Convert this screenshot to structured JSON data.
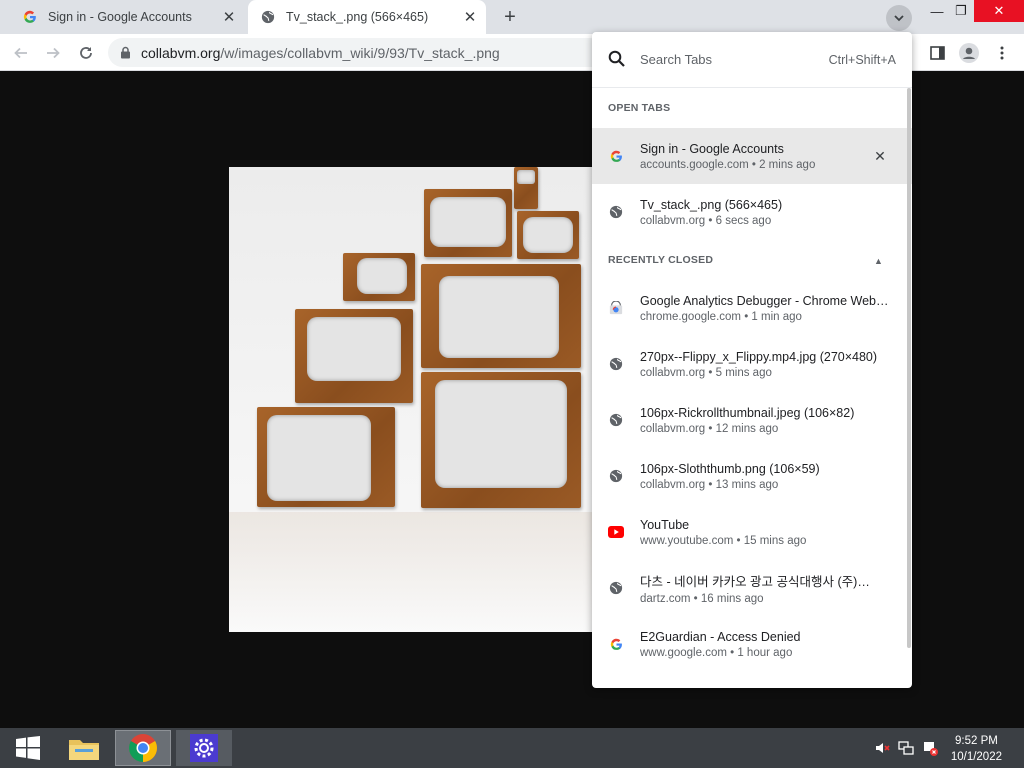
{
  "browser": {
    "tabs": [
      {
        "title": "Sign in - Google Accounts",
        "active": false
      },
      {
        "title": "Tv_stack_.png (566×465)",
        "active": true
      }
    ],
    "address": {
      "host": "collabvm.org",
      "path": "/w/images/collabvm_wiki/9/93/Tv_stack_.png"
    }
  },
  "tab_search": {
    "placeholder": "Search Tabs",
    "shortcut": "Ctrl+Shift+A",
    "open_tabs_header": "OPEN TABS",
    "recently_closed_header": "RECENTLY CLOSED",
    "open_tabs": [
      {
        "title": "Sign in - Google Accounts",
        "subtitle": "accounts.google.com • 2 mins ago",
        "icon": "google-icon"
      },
      {
        "title": "Tv_stack_.png (566×465)",
        "subtitle": "collabvm.org • 6 secs ago",
        "icon": "globe-icon"
      }
    ],
    "recently_closed": [
      {
        "title": "Google Analytics Debugger - Chrome Web…",
        "subtitle": "chrome.google.com • 1 min ago",
        "icon": "webstore-icon"
      },
      {
        "title": "270px--Flippy_x_Flippy.mp4.jpg (270×480)",
        "subtitle": "collabvm.org • 5 mins ago",
        "icon": "globe-icon"
      },
      {
        "title": "106px-Rickrollthumbnail.jpeg (106×82)",
        "subtitle": "collabvm.org • 12 mins ago",
        "icon": "globe-icon"
      },
      {
        "title": "106px-Sloththumb.png (106×59)",
        "subtitle": "collabvm.org • 13 mins ago",
        "icon": "globe-icon"
      },
      {
        "title": "YouTube",
        "subtitle": "www.youtube.com • 15 mins ago",
        "icon": "youtube-icon"
      },
      {
        "title": "다츠 - 네이버 카카오 광고 공식대행사 (주)…",
        "subtitle": "dartz.com • 16 mins ago",
        "icon": "globe-icon"
      },
      {
        "title": "E2Guardian - Access Denied",
        "subtitle": "www.google.com • 1 hour ago",
        "icon": "google-icon"
      }
    ]
  },
  "taskbar": {
    "time": "9:52 PM",
    "date": "10/1/2022"
  }
}
